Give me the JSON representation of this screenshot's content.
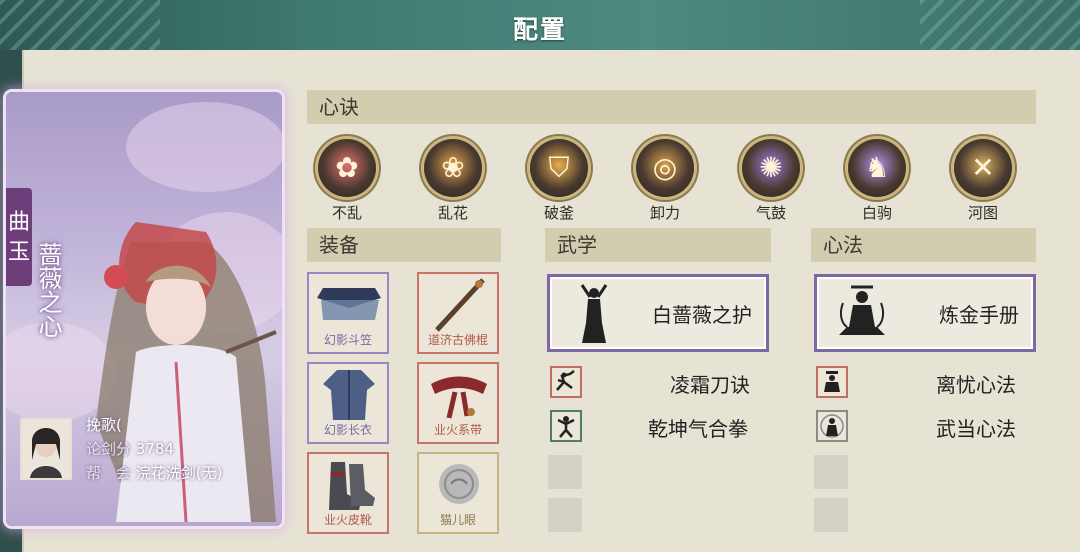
{
  "window": {
    "title": "配置"
  },
  "character": {
    "tab_text": "曲 玉",
    "title": "蔷薇之心",
    "player_name": "挽歌(",
    "score_label": "论剑分",
    "score": "3784",
    "guild_label": "帮　会",
    "guild": "浣花洗剑(无)"
  },
  "xinjue": {
    "header": "心诀",
    "items": [
      {
        "label": "不乱",
        "icon": "flower-spirit-icon",
        "color": "#e57070"
      },
      {
        "label": "乱花",
        "icon": "flower-hand-icon",
        "color": "#e0a24a"
      },
      {
        "label": "破釜",
        "icon": "shield-icon",
        "color": "#e8b04c"
      },
      {
        "label": "卸力",
        "icon": "swirl-icon",
        "color": "#d9a14a"
      },
      {
        "label": "气鼓",
        "icon": "purple-burst-icon",
        "color": "#a07ae0"
      },
      {
        "label": "白驹",
        "icon": "horse-icon",
        "color": "#b590e8"
      },
      {
        "label": "河图",
        "icon": "crossed-swords-icon",
        "color": "#d9b060"
      }
    ]
  },
  "equipment": {
    "header": "装备",
    "items": [
      {
        "label": "幻影斗笠",
        "icon": "hat-icon",
        "rarity": "purple"
      },
      {
        "label": "道济古佛棍",
        "icon": "staff-icon",
        "rarity": "red"
      },
      {
        "label": "幻影长衣",
        "icon": "robe-icon",
        "rarity": "purple"
      },
      {
        "label": "业火系带",
        "icon": "belt-icon",
        "rarity": "red"
      },
      {
        "label": "业火皮靴",
        "icon": "boots-icon",
        "rarity": "red"
      },
      {
        "label": "猫儿眼",
        "icon": "coin-icon",
        "rarity": "gold"
      }
    ]
  },
  "wuxue": {
    "header": "武学",
    "main": {
      "label": "白蔷薇之护",
      "icon": "dancer-silhouette-icon"
    },
    "skills": [
      {
        "label": "凌霜刀诀",
        "icon": "blade-fighter-icon",
        "frame": "red"
      },
      {
        "label": "乾坤气合拳",
        "icon": "fist-fighter-icon",
        "frame": "green"
      }
    ]
  },
  "xinfa": {
    "header": "心法",
    "main": {
      "label": "炼金手册",
      "icon": "meditating-alchemist-icon"
    },
    "skills": [
      {
        "label": "离忧心法",
        "icon": "seated-sage-icon",
        "frame": "red"
      },
      {
        "label": "武当心法",
        "icon": "taoist-sage-icon",
        "frame": "grey"
      }
    ]
  }
}
